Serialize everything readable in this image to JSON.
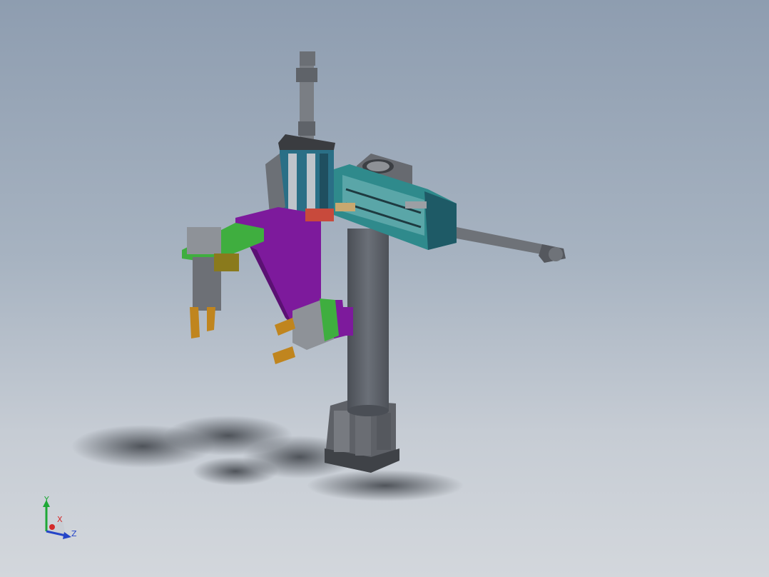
{
  "triad": {
    "y_label": "Y",
    "x_label": "X",
    "z_label": "Z",
    "colors": {
      "y": "#1ea836",
      "x": "#d42a2a",
      "z": "#2545c8"
    }
  },
  "model_colors": {
    "column": "#5c6068",
    "base": "#6e7177",
    "plate": "#7d1a9c",
    "gripper_mount": "#3fae3f",
    "slide_body": "#2f8a8c",
    "slide_dark": "#1e5a66",
    "cylinder": "#8a8e94",
    "jaw": "#c0851e",
    "accent_red": "#c84a3c",
    "block_dark": "#3a3c40"
  }
}
